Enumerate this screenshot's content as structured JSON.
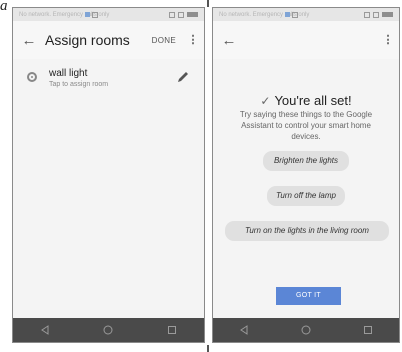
{
  "figure_label": "a",
  "left_screen": {
    "status": {
      "carrier": "No network. Emergency calls only"
    },
    "appbar": {
      "back_icon": "arrow-back-icon",
      "title": "Assign rooms",
      "done_label": "DONE",
      "more_icon": "more-vert-icon"
    },
    "device": {
      "icon": "lightbulb-icon",
      "name": "wall light",
      "subtitle": "Tap to assign room",
      "edit_icon": "pencil-icon"
    },
    "navbar": {
      "icons": [
        "back-triangle-icon",
        "home-circle-icon",
        "recents-square-icon"
      ]
    }
  },
  "right_screen": {
    "status": {
      "carrier": "No network. Emergency calls only"
    },
    "appbar": {
      "back_icon": "arrow-back-icon",
      "more_icon": "more-vert-icon"
    },
    "title": "You're all set!",
    "message": "Try saying these things to the Google Assistant to control your smart home devices.",
    "suggestions": [
      "Brighten the lights",
      "Turn off the lamp",
      "Turn on the lights in the living room"
    ],
    "got_it_label": "GOT IT",
    "accent_color": "#5b86d6",
    "navbar": {
      "icons": [
        "back-triangle-icon",
        "home-circle-icon",
        "recents-square-icon"
      ]
    }
  }
}
